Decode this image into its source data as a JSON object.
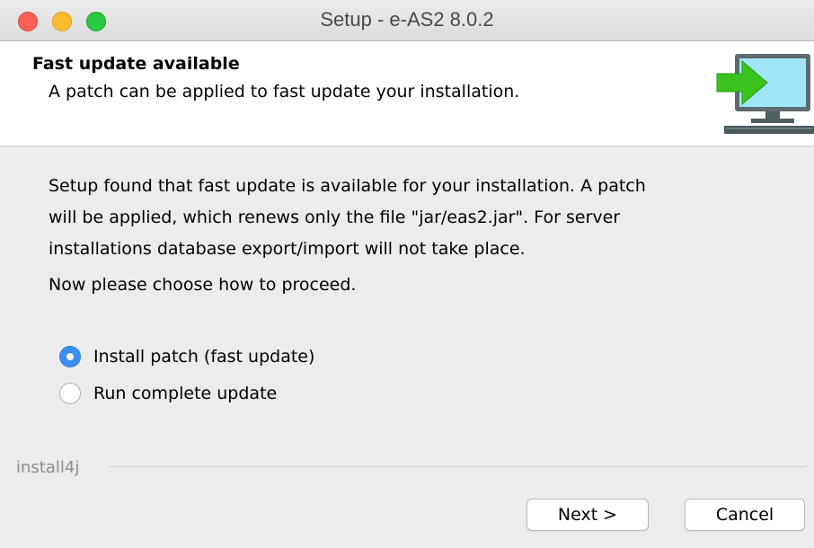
{
  "window": {
    "title": "Setup - e-AS2 8.0.2"
  },
  "header": {
    "title": "Fast update available",
    "subtitle": "A patch can be applied to fast update your installation.",
    "icon": "monitor-arrow-icon"
  },
  "body": {
    "description_lines": [
      "Setup found that fast update is available for your installation. A patch",
      "will be applied, which renews only the file \"jar/eas2.jar\". For server",
      "installations database export/import will not take place."
    ],
    "prompt": "Now please choose how to proceed.",
    "options": [
      {
        "label": "Install patch (fast update)",
        "selected": true
      },
      {
        "label": "Run complete update",
        "selected": false
      }
    ]
  },
  "footer": {
    "brand": "install4j",
    "next_label": "Next >",
    "cancel_label": "Cancel"
  },
  "colors": {
    "accent": "#3a8ff2",
    "close": "#fd5f57",
    "minimize": "#fdbc2e",
    "maximize": "#28c840",
    "icon_green": "#3cc21f",
    "icon_screen": "#9fe6f7"
  }
}
